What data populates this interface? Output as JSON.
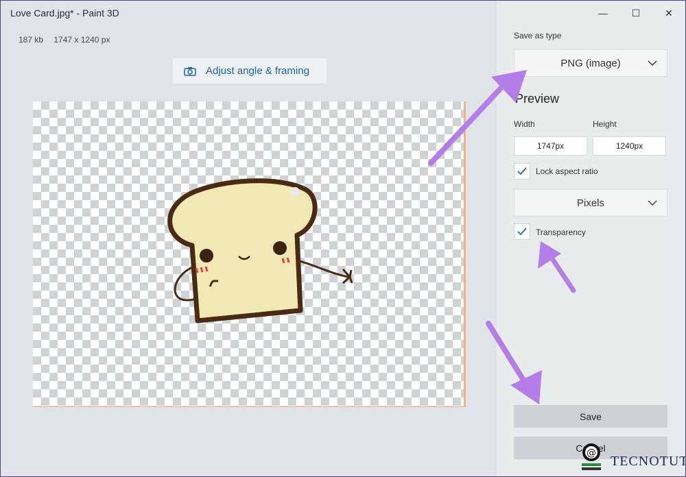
{
  "window": {
    "title": "Love Card.jpg* - Paint 3D",
    "controls": {
      "minimize": "—",
      "maximize": "☐",
      "close": "✕"
    }
  },
  "file_info": {
    "size": "187 kb",
    "dimensions": "1747 x 1240 px"
  },
  "adjust_button": {
    "label": "Adjust angle & framing",
    "icon": "camera-icon"
  },
  "panel": {
    "save_as_type_label": "Save as type",
    "save_as_type_value": "PNG (image)",
    "preview_heading": "Preview",
    "width_label": "Width",
    "width_value": "1747px",
    "height_label": "Height",
    "height_value": "1240px",
    "lock_aspect_label": "Lock aspect ratio",
    "lock_aspect_checked": true,
    "units_value": "Pixels",
    "transparency_label": "Transparency",
    "transparency_checked": true,
    "save_label": "Save",
    "cancel_label": "Cancel"
  },
  "watermark": {
    "text": "TECNOTUTO"
  },
  "colors": {
    "accent": "#1f62a8",
    "arrow": "#b57de8",
    "canvas_border": "#f3b184"
  }
}
